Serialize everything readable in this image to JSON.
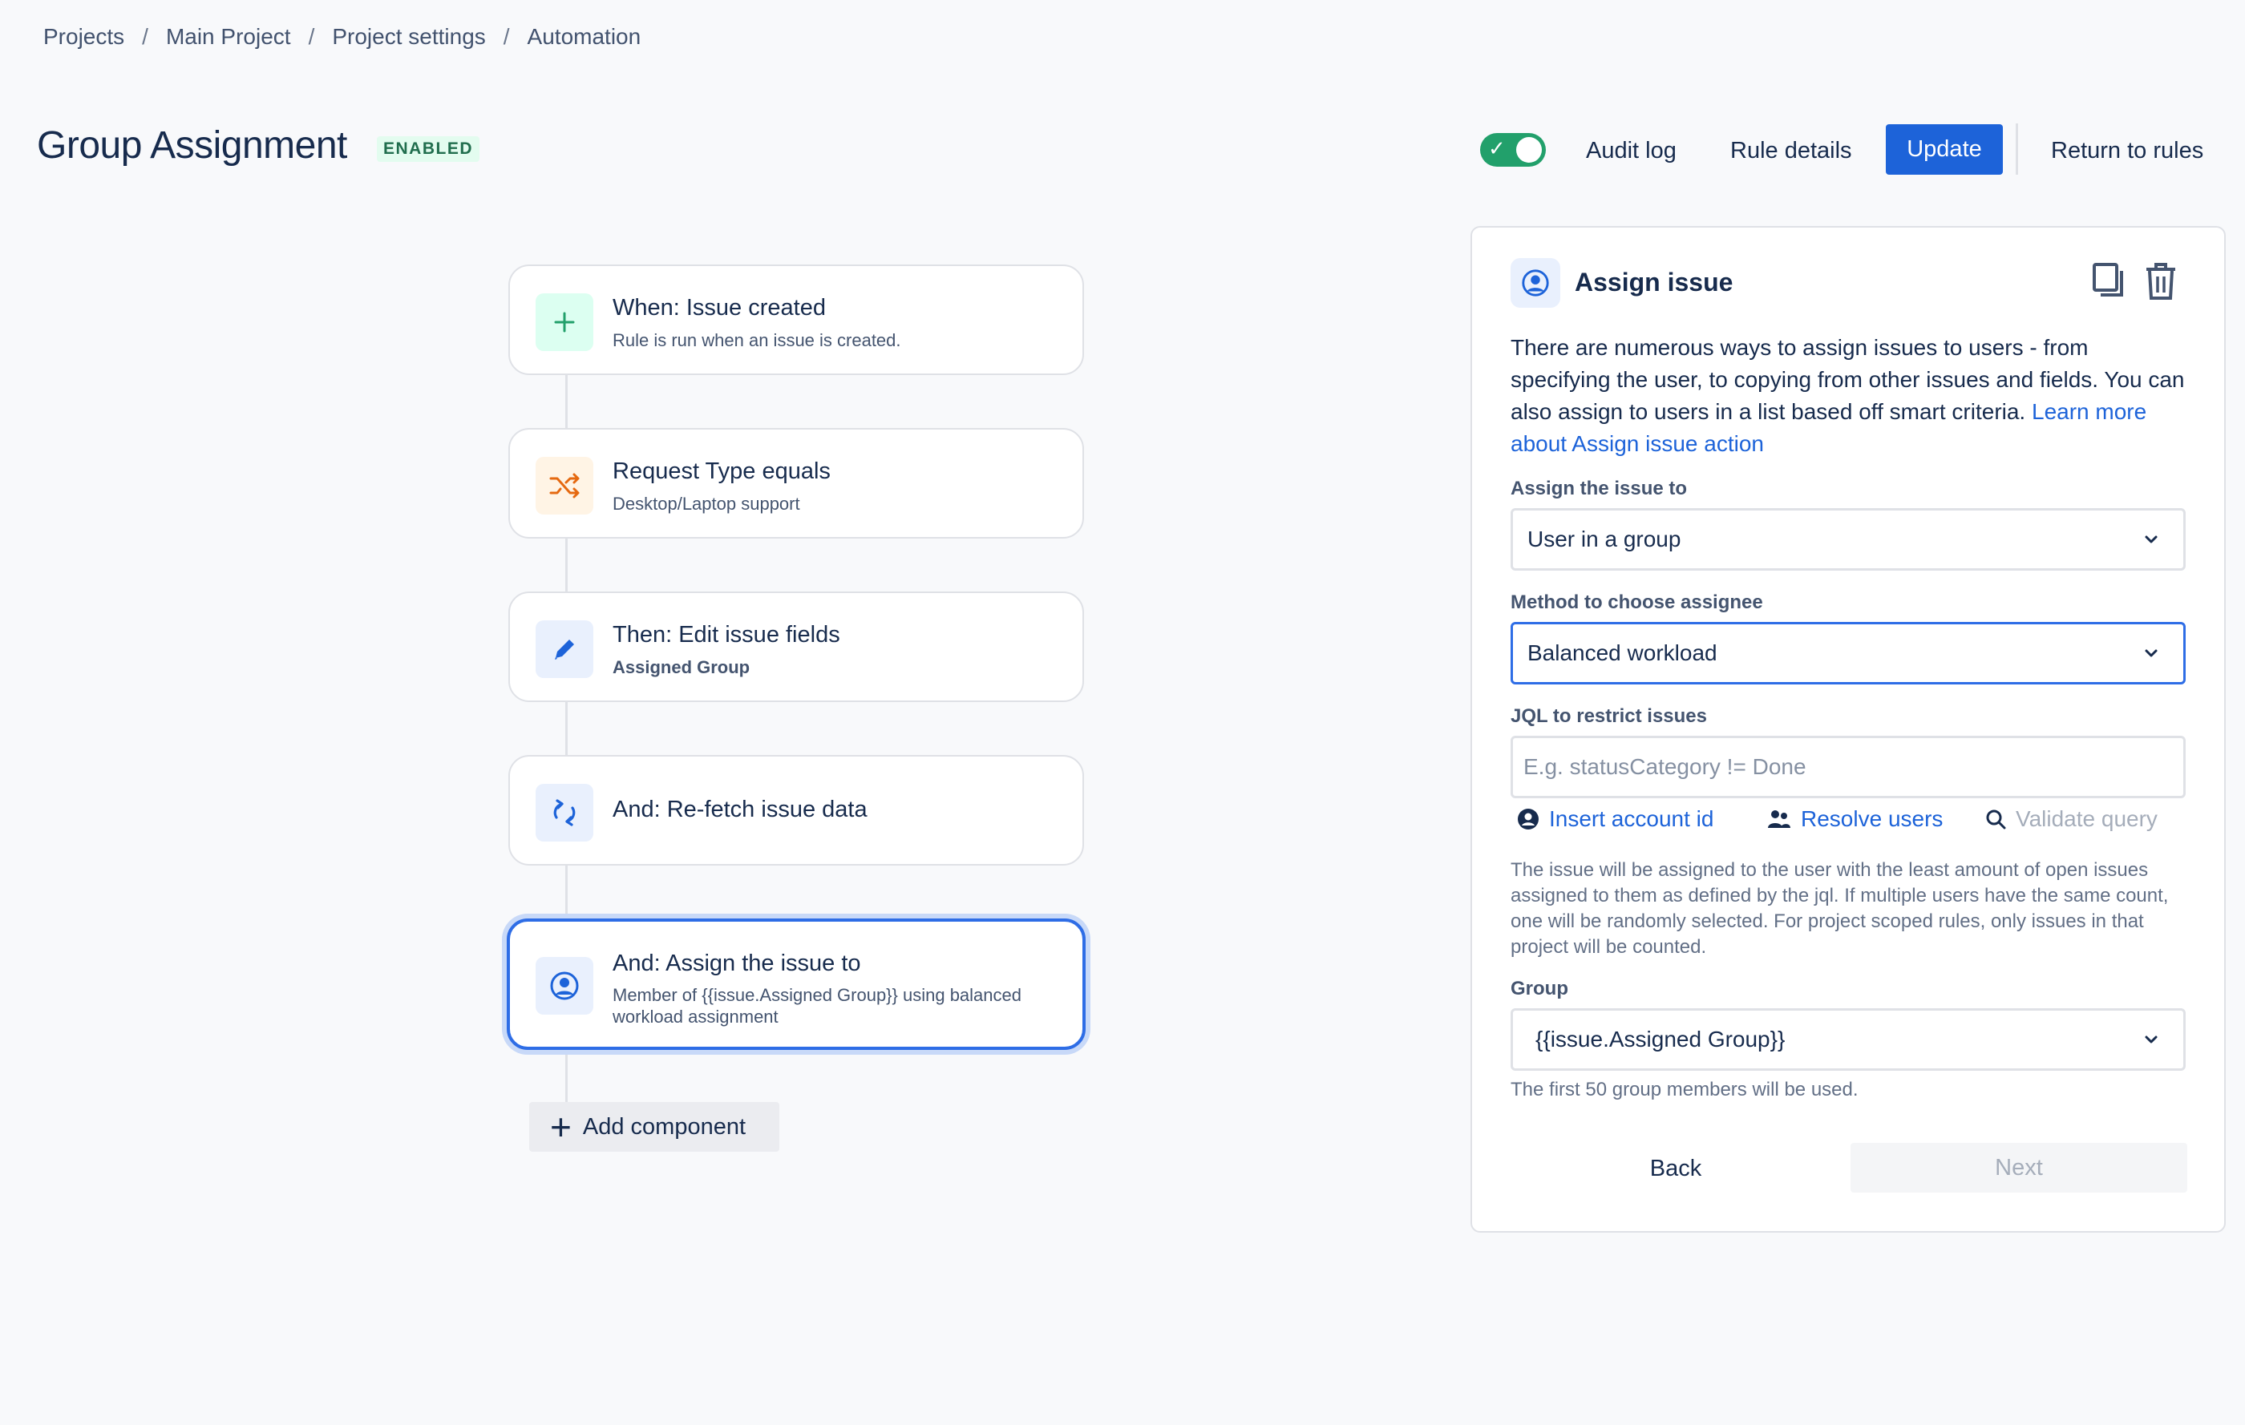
{
  "breadcrumb": {
    "items": [
      "Projects",
      "Main Project",
      "Project settings",
      "Automation"
    ],
    "separator": "/"
  },
  "header": {
    "title": "Group Assignment",
    "status": "ENABLED",
    "rule_enabled": true,
    "audit_log": "Audit log",
    "rule_details": "Rule details",
    "update": "Update",
    "return_to_rules": "Return to rules"
  },
  "flow": {
    "steps": [
      {
        "title": "When: Issue created",
        "subtitle": "Rule is run when an issue is created.",
        "icon": "plus-icon"
      },
      {
        "title": "Request Type equals",
        "subtitle": "Desktop/Laptop support",
        "icon": "shuffle-icon"
      },
      {
        "title": "Then: Edit issue fields",
        "subtitle": "Assigned Group",
        "icon": "pencil-icon"
      },
      {
        "title": "And: Re-fetch issue data",
        "subtitle": "",
        "icon": "refresh-icon"
      },
      {
        "title": "And: Assign the issue to",
        "subtitle": "Member of {{issue.Assigned Group}} using balanced workload assignment",
        "icon": "user-circle-icon"
      }
    ],
    "add_component": "Add component"
  },
  "panel": {
    "title": "Assign issue",
    "description": "There are numerous ways to assign issues to users - from specifying the user, to copying from other issues and fields. You can also assign to users in a list based off smart criteria.",
    "learn_more": "Learn more about Assign issue action",
    "assign_label": "Assign the issue to",
    "assign_value": "User in a group",
    "method_label": "Method to choose assignee",
    "method_value": "Balanced workload",
    "jql_label": "JQL to restrict issues",
    "jql_placeholder": "E.g. statusCategory != Done",
    "jql_value": "",
    "insert_account_id": "Insert account id",
    "resolve_users": "Resolve users",
    "validate_query": "Validate query",
    "method_help": "The issue will be assigned to the user with the least amount of open issues assigned to them as defined by the jql. If multiple users have the same count, one will be randomly selected. For project scoped rules, only issues in that project will be counted.",
    "group_label": "Group",
    "group_value": "{{issue.Assigned Group}}",
    "group_help": "The first 50 group members will be used.",
    "back": "Back",
    "next": "Next"
  },
  "colors": {
    "primary": "#1d63d9",
    "toggle_on": "#22a06b",
    "badge_bg": "#e3fcef",
    "badge_text": "#216e4e",
    "selected_border": "#2e6de6"
  }
}
